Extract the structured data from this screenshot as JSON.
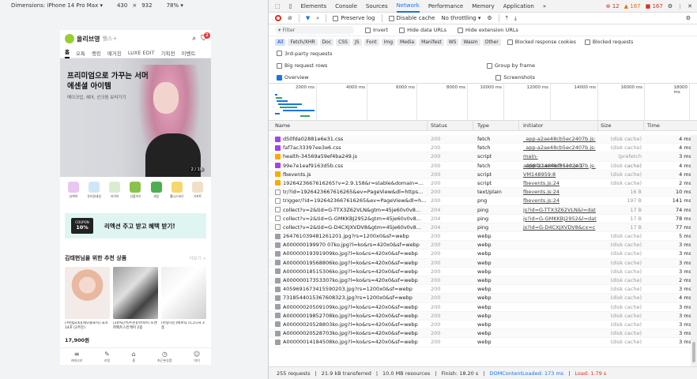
{
  "device_toolbar": {
    "dimensions": "Dimensions: iPhone 14 Pro Max ▾",
    "width": "430",
    "x": "×",
    "height": "932",
    "zoom": "78% ▾"
  },
  "phone": {
    "brand": "올리브영",
    "search_hint": "웰스+",
    "cart_count": "2",
    "tabs": [
      "홈",
      "오특",
      "랭킹",
      "매거진",
      "LUXE EDIT",
      "기획전",
      "이벤트"
    ],
    "banner": {
      "title": "프리미엄으로 가꾸는 서머 에센셜 아이템",
      "subtitle": "메이크업, 헤어, 선크림 보러가기",
      "page": "2 / 19"
    },
    "categories": [
      "뷰케어",
      "온리원세일",
      "타이어",
      "선물하기",
      "세일",
      "웰니스코너",
      "기프트"
    ],
    "promo": {
      "coupon_label": "COUPON",
      "coupon_value": "10%",
      "text": "리엑션 주고 받고 혜택 받기!"
    },
    "section": {
      "title": "김태현님을 위한 추천 상품",
      "more": "더보기 >"
    },
    "products": [
      {
        "name": "[서현pick][제오볼로지] 효소 14포 (2주분)",
        "price": "17,900원"
      },
      {
        "name": "[20%단독추천][아비브] 포맨 퍼펙트스킨케어 2종",
        "price": ""
      },
      {
        "name": "[아랑하는]에보닉 리그니처 3종",
        "price": ""
      }
    ],
    "bottom_nav": [
      "카테고리",
      "리빙",
      "홈",
      "최근본상품",
      "마이"
    ]
  },
  "devtools": {
    "tabs": [
      "Elements",
      "Console",
      "Sources",
      "Network",
      "Performance",
      "Memory",
      "Application",
      "»"
    ],
    "active_tab": "Network",
    "errors": "12",
    "warnings": "167",
    "issues": "167",
    "toolbar": {
      "preserve_log": "Preserve log",
      "disable_cache": "Disable cache",
      "throttling": "No throttling ▾"
    },
    "filter": {
      "placeholder": "Filter",
      "invert": "Invert",
      "hide_data": "Hide data URLs",
      "hide_ext": "Hide extension URLs"
    },
    "chips": [
      "All",
      "Fetch/XHR",
      "Doc",
      "CSS",
      "JS",
      "Font",
      "Img",
      "Media",
      "Manifest",
      "WS",
      "Wasm",
      "Other"
    ],
    "blocked_cookies": "Blocked response cookies",
    "blocked_requests": "Blocked requests",
    "third_party": "3rd-party requests",
    "big_rows": "Big request rows",
    "group_by_frame": "Group by frame",
    "overview": "Overview",
    "screenshots": "Screenshots",
    "ticks": [
      "2000 ms",
      "4000 ms",
      "6000 ms",
      "8000 ms",
      "10000 ms",
      "12000 ms",
      "14000 ms",
      "16000 ms",
      "18000 ms"
    ],
    "columns": [
      "Name",
      "Status",
      "Type",
      "Initiator",
      "Size",
      "Time"
    ],
    "rows": [
      {
        "icon": "css",
        "name": "d50fda02881e6e31.css",
        "status": "200",
        "type": "fetch",
        "initiator": "_app-a2ae48cb5ec2407b.js:",
        "size": "(disk cache)",
        "time": "4 ms"
      },
      {
        "icon": "css",
        "name": "faf7ac33397ee3e6.css",
        "status": "200",
        "type": "fetch",
        "initiator": "_app-a2ae48cb5ec2407b.js:",
        "size": "(disk cache)",
        "time": "4 ms"
      },
      {
        "icon": "js",
        "name": "health-34569a59ef4ba249.js",
        "status": "200",
        "type": "script",
        "initiator": "main-a098f21484ef8119.js:1",
        "size": "(prefetch cache)",
        "time": "3 ms"
      },
      {
        "icon": "css",
        "name": "99e7e1eaf9163d5b.css",
        "status": "200",
        "type": "fetch",
        "initiator": "_app-a2ae48cb5ec2407b.js:",
        "size": "(disk cache)",
        "time": "4 ms"
      },
      {
        "icon": "js",
        "name": "fbevents.js",
        "status": "200",
        "type": "script",
        "initiator": "VM148959:8",
        "size": "(disk cache)",
        "time": "4 ms"
      },
      {
        "icon": "js",
        "name": "1926423667616265?v=2.9.158&r=stable&domain=...",
        "status": "200",
        "type": "script",
        "initiator": "fbevents.js:24",
        "size": "(disk cache)",
        "time": "2 ms"
      },
      {
        "icon": "doc",
        "name": "tr/?id=1926423667616265&ev=PageView&dl=https...",
        "status": "200",
        "type": "text/plain",
        "initiator": "fbevents.js:24",
        "size": "16 B",
        "time": "10 ms"
      },
      {
        "icon": "doc",
        "name": "trigger/?id=1926423667616265&ev=PageView&dl=h...",
        "status": "200",
        "type": "png",
        "initiator": "fbevents.js:24",
        "size": "197 B",
        "time": "141 ms"
      },
      {
        "icon": "doc",
        "name": "collect?v=2&tid=G-TTX3Z62VLN&gtm=45je60v0v8...",
        "status": "204",
        "type": "ping",
        "initiator": "js?id=G-TTX3Z62VLN&l=dat",
        "size": "17 B",
        "time": "74 ms"
      },
      {
        "icon": "doc",
        "name": "collect?v=2&tid=G-GMKKBJ2952&gtm=45je60v0v8...",
        "status": "204",
        "type": "ping",
        "initiator": "js?id=G-GMKKBJ2952&l=dat",
        "size": "17 B",
        "time": "78 ms"
      },
      {
        "icon": "doc",
        "name": "collect?v=2&tid=G-D4CXJXVDV8&gtm=45je60v0v8...",
        "status": "204",
        "type": "ping",
        "initiator": "js?id=G-D4CXJXVDV8&cx=c",
        "size": "17 B",
        "time": "77 ms"
      },
      {
        "icon": "img",
        "name": "264761039481261201.jpg?rs=1200x0&sf=webp",
        "status": "200",
        "type": "webp",
        "initiator": "",
        "size": "(disk cache)",
        "time": "5 ms"
      },
      {
        "icon": "img",
        "name": "A000000199970 07ko.jpg?l=ko&rs=420x0&sf=webp",
        "status": "200",
        "type": "webp",
        "initiator": "",
        "size": "(disk cache)",
        "time": "3 ms"
      },
      {
        "icon": "img",
        "name": "A00000019391909ko.jpg?l=ko&rs=420x0&sf=webp",
        "status": "200",
        "type": "webp",
        "initiator": "",
        "size": "(disk cache)",
        "time": "3 ms"
      },
      {
        "icon": "img",
        "name": "A00000019568806ko.jpg?l=ko&rs=420x0&sf=webp",
        "status": "200",
        "type": "webp",
        "initiator": "",
        "size": "(disk cache)",
        "time": "3 ms"
      },
      {
        "icon": "img",
        "name": "A00000018515306ko.jpg?l=ko&rs=420x0&sf=webp",
        "status": "200",
        "type": "webp",
        "initiator": "",
        "size": "(disk cache)",
        "time": "3 ms"
      },
      {
        "icon": "img",
        "name": "A00000017353307ko.jpg?l=ko&rs=420x0&sf=webp",
        "status": "200",
        "type": "webp",
        "initiator": "",
        "size": "(disk cache)",
        "time": "2 ms"
      },
      {
        "icon": "img",
        "name": "4059691673415590203.jpg?rs=1200x0&sf=webp",
        "status": "200",
        "type": "webp",
        "initiator": "",
        "size": "(disk cache)",
        "time": "3 ms"
      },
      {
        "icon": "img",
        "name": "7318544015367608323.jpg?rs=1200x0&sf=webp",
        "status": "200",
        "type": "webp",
        "initiator": "",
        "size": "(disk cache)",
        "time": "4 ms"
      },
      {
        "icon": "img",
        "name": "A00000020509109ko.jpg?l=ko&rs=420x0&sf=webp",
        "status": "200",
        "type": "webp",
        "initiator": "",
        "size": "(disk cache)",
        "time": "3 ms"
      },
      {
        "icon": "img",
        "name": "A00000019852708ko.jpg?l=ko&rs=420x0&sf=webp",
        "status": "200",
        "type": "webp",
        "initiator": "",
        "size": "(disk cache)",
        "time": "3 ms"
      },
      {
        "icon": "img",
        "name": "A00000020528803ko.jpg?l=ko&rs=420x0&sf=webp",
        "status": "200",
        "type": "webp",
        "initiator": "",
        "size": "(disk cache)",
        "time": "3 ms"
      },
      {
        "icon": "img",
        "name": "A00000020528703ko.jpg?l=ko&rs=420x0&sf=webp",
        "status": "200",
        "type": "webp",
        "initiator": "",
        "size": "(disk cache)",
        "time": "3 ms"
      },
      {
        "icon": "img",
        "name": "A00000014184508ko.jpg?l=ko&rs=420x0&sf=webp",
        "status": "200",
        "type": "webp",
        "initiator": "",
        "size": "(disk cache)",
        "time": "3 ms"
      }
    ],
    "status_bar": {
      "requests": "255 requests",
      "transferred": "21.9 kB transferred",
      "resources": "10.0 MB resources",
      "finish": "Finish: 18.20 s",
      "dcl": "DOMContentLoaded: 173 ms",
      "load": "Load: 1.79 s"
    }
  }
}
